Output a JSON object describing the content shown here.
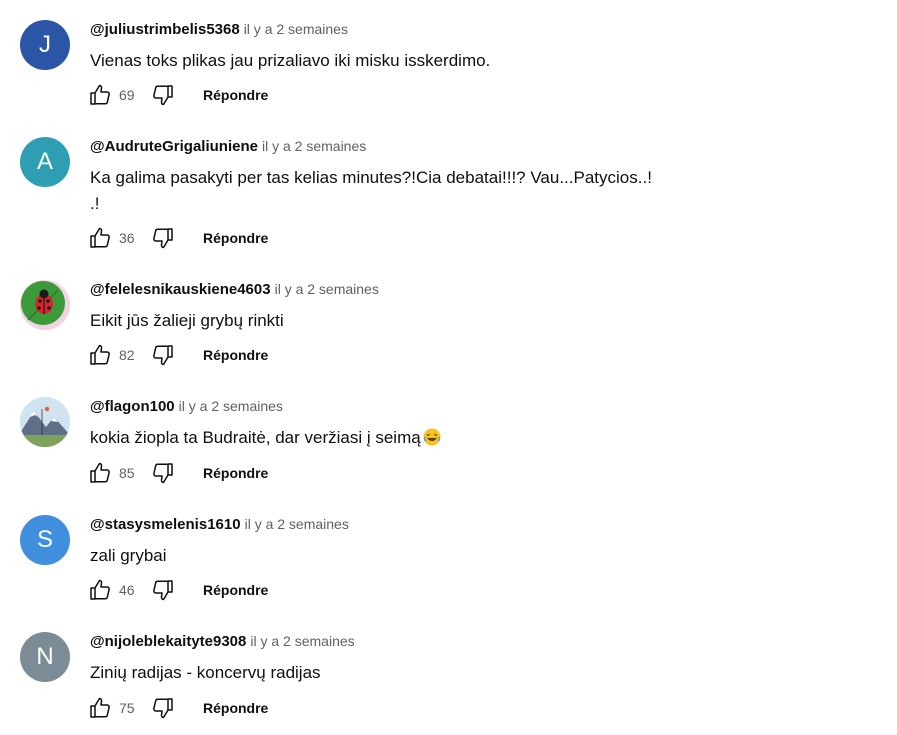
{
  "reply_label": "Répondre",
  "comments": [
    {
      "author": "@juliustrimbelis5368",
      "time": "il y a 2 semaines",
      "text": "Vienas toks plikas jau prizaliavo iki misku isskerdimo.",
      "likes": "69",
      "avatar": {
        "letter": "J",
        "color": "#2b56a6"
      }
    },
    {
      "author": "@AudruteGrigaliuniene",
      "time": "il y a 2 semaines",
      "text": "Ka galima pasakyti per tas kelias minutes?!Cia debatai!!!? Vau...Patycios..!\n.!",
      "likes": "36",
      "avatar": {
        "letter": "A",
        "color": "#2e9fb3"
      }
    },
    {
      "author": "@felelesnikauskiene4603",
      "time": "il y a 2 semaines",
      "text": "Eikit jūs žalieji grybų rinkti",
      "likes": "82",
      "avatar": {
        "icon": "ladybug-leaf-icon"
      }
    },
    {
      "author": "@flagon100",
      "time": "il y a 2 semaines",
      "text": "kokia žiopla ta Budraitė, dar veržiasi į seimą",
      "likes": "85",
      "avatar": {
        "icon": "mountain-landscape-icon"
      }
    },
    {
      "author": "@stasysmelenis1610",
      "time": "il y a 2 semaines",
      "text": "zali grybai",
      "likes": "46",
      "avatar": {
        "letter": "S",
        "color": "#3f8fde"
      }
    },
    {
      "author": "@nijoleblekaityte9308",
      "time": "il y a 2 semaines",
      "text": "Zinių radijas - koncervų radijas",
      "likes": "75",
      "avatar": {
        "letter": "N",
        "color": "#7b8c97"
      }
    }
  ]
}
